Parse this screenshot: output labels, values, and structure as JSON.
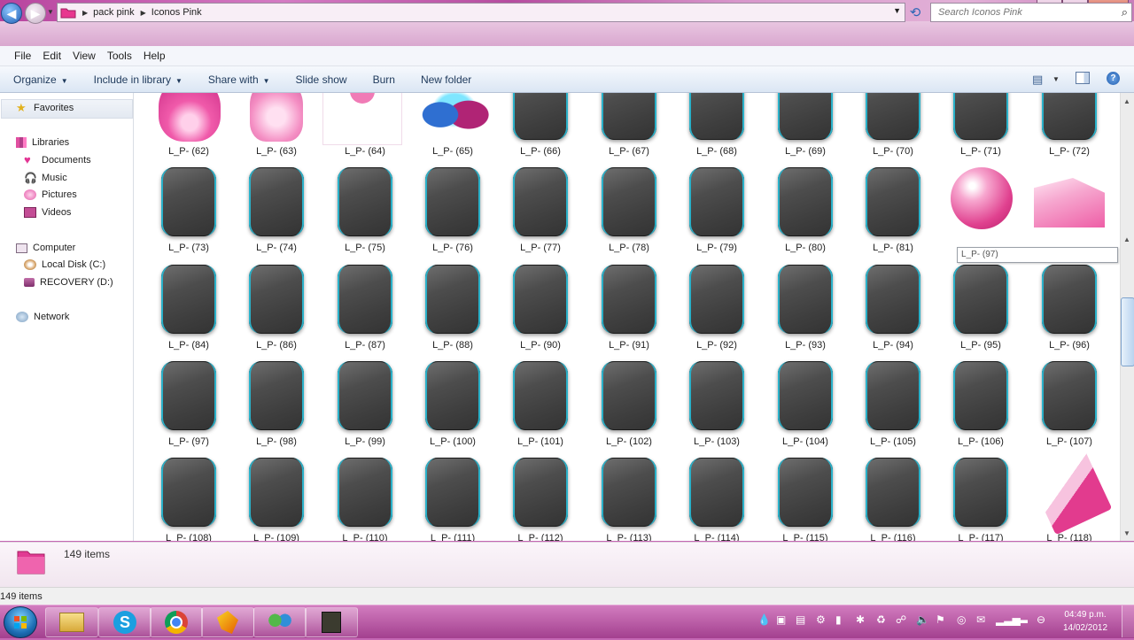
{
  "window": {
    "breadcrumb": [
      "pack pink",
      "Iconos Pink"
    ],
    "search_placeholder": "Search Iconos Pink"
  },
  "menu": [
    "File",
    "Edit",
    "View",
    "Tools",
    "Help"
  ],
  "commands": [
    {
      "label": "Organize",
      "dropdown": true
    },
    {
      "label": "Include in library",
      "dropdown": true
    },
    {
      "label": "Share with",
      "dropdown": true
    },
    {
      "label": "Slide show",
      "dropdown": false
    },
    {
      "label": "Burn",
      "dropdown": false
    },
    {
      "label": "New folder",
      "dropdown": false
    }
  ],
  "nav": {
    "favorites": "Favorites",
    "libraries": "Libraries",
    "library_items": [
      "Documents",
      "Music",
      "Pictures",
      "Videos"
    ],
    "computer": "Computer",
    "drives": [
      "Local Disk (C:)",
      "RECOVERY (D:)"
    ],
    "network": "Network"
  },
  "files": {
    "rows": [
      [
        "L_P- (62)",
        "L_P- (63)",
        "L_P- (64)",
        "L_P- (65)",
        "L_P- (66)",
        "L_P- (67)",
        "L_P- (68)",
        "L_P- (69)",
        "L_P- (70)",
        "L_P- (71)",
        "L_P- (72)"
      ],
      [
        "L_P- (73)",
        "L_P- (74)",
        "L_P- (75)",
        "L_P- (76)",
        "L_P- (77)",
        "L_P- (78)",
        "L_P- (79)",
        "L_P- (80)",
        "L_P- (81)",
        "",
        ""
      ],
      [
        "L_P- (84)",
        "L_P- (86)",
        "L_P- (87)",
        "L_P- (88)",
        "L_P- (90)",
        "L_P- (91)",
        "L_P- (92)",
        "L_P- (93)",
        "L_P- (94)",
        "L_P- (95)",
        "L_P- (96)"
      ],
      [
        "L_P- (97)",
        "L_P- (98)",
        "L_P- (99)",
        "L_P- (100)",
        "L_P- (101)",
        "L_P- (102)",
        "L_P- (103)",
        "L_P- (104)",
        "L_P- (105)",
        "L_P- (106)",
        "L_P- (107)"
      ],
      [
        "L_P- (108)",
        "L_P- (109)",
        "L_P- (110)",
        "L_P- (111)",
        "L_P- (112)",
        "L_P- (113)",
        "L_P- (114)",
        "L_P- (115)",
        "L_P- (116)",
        "L_P- (117)",
        "L_P- (118)"
      ]
    ],
    "special_icons": {
      "0-0": "pink-bear-icon",
      "0-1": "pink-penguin-icon",
      "0-2": "pink-paw-icon",
      "0-3": "pink-couple-icon",
      "1-9": "pink-globe-icon",
      "1-10": "pink-folder-icon",
      "4-10": "pink-planner-icon"
    }
  },
  "tooltip": "L_P- (97)",
  "details": {
    "count": "149 items"
  },
  "status": {
    "count": "149 items"
  },
  "taskbar": {
    "apps": [
      "explorer-icon",
      "skype-icon",
      "chrome-icon",
      "winamp-icon",
      "messenger-icon",
      "camera-app-icon"
    ],
    "time": "04:49 p.m.",
    "date": "14/02/2012"
  },
  "colors": {
    "accent_pink": "#c468b4",
    "tile_edge": "#2ab1c9",
    "nav_blue": "#1f5fb4"
  }
}
